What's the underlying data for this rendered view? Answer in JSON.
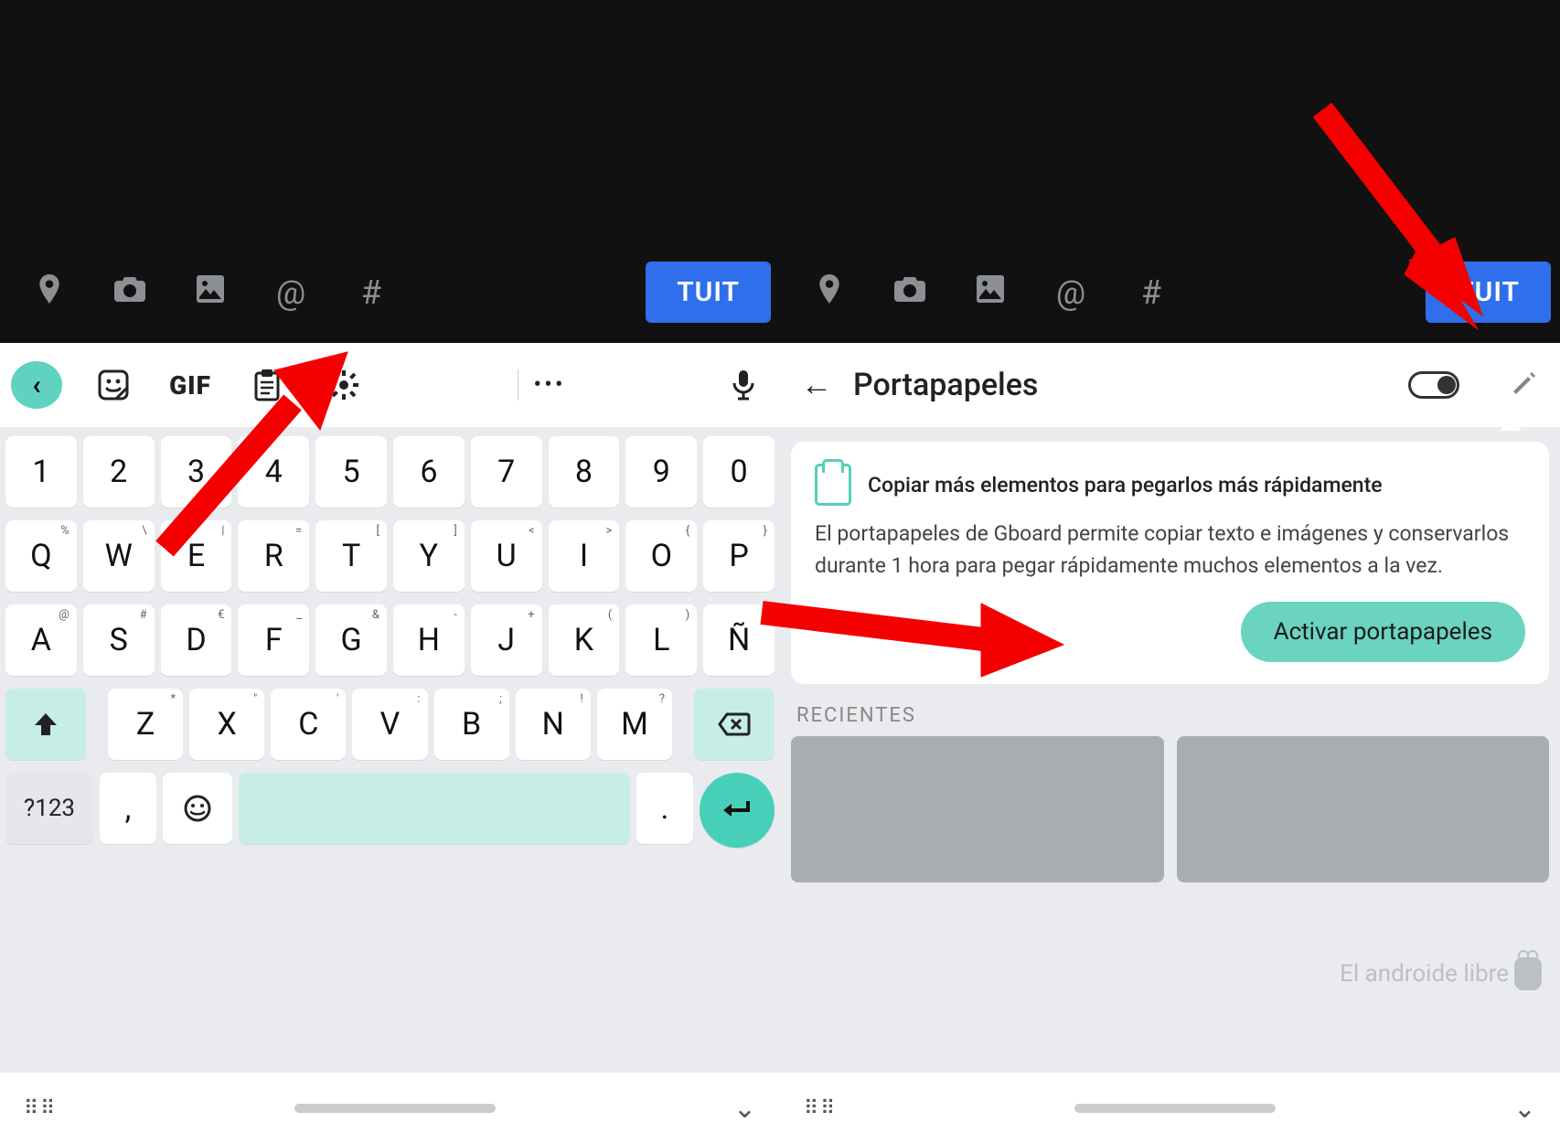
{
  "compose": {
    "icons": [
      "location",
      "camera",
      "gallery",
      "at",
      "hash"
    ],
    "button": "TUIT"
  },
  "strip": {
    "back": "‹",
    "sticker": "sticker",
    "gif": "GIF",
    "clipboard": "clipboard",
    "settings": "settings",
    "more": "•••",
    "mic": "mic"
  },
  "keys": {
    "row1": [
      "1",
      "2",
      "3",
      "4",
      "5",
      "6",
      "7",
      "8",
      "9",
      "0"
    ],
    "row2": [
      {
        "k": "Q",
        "s": "%"
      },
      {
        "k": "W",
        "s": "\\"
      },
      {
        "k": "E",
        "s": "|"
      },
      {
        "k": "R",
        "s": "="
      },
      {
        "k": "T",
        "s": "["
      },
      {
        "k": "Y",
        "s": "]"
      },
      {
        "k": "U",
        "s": "<"
      },
      {
        "k": "I",
        "s": ">"
      },
      {
        "k": "O",
        "s": "{"
      },
      {
        "k": "P",
        "s": "}"
      }
    ],
    "row3": [
      {
        "k": "A",
        "s": "@"
      },
      {
        "k": "S",
        "s": "#"
      },
      {
        "k": "D",
        "s": "€"
      },
      {
        "k": "F",
        "s": "_"
      },
      {
        "k": "G",
        "s": "&"
      },
      {
        "k": "H",
        "s": "-"
      },
      {
        "k": "J",
        "s": "+"
      },
      {
        "k": "K",
        "s": "("
      },
      {
        "k": "L",
        "s": ")"
      },
      {
        "k": "Ñ",
        "s": "/"
      }
    ],
    "row4": [
      {
        "k": "Z",
        "s": "*"
      },
      {
        "k": "X",
        "s": "\""
      },
      {
        "k": "C",
        "s": "'"
      },
      {
        "k": "V",
        "s": ":"
      },
      {
        "k": "B",
        "s": ";"
      },
      {
        "k": "N",
        "s": "!"
      },
      {
        "k": "M",
        "s": "?"
      }
    ],
    "shift": "⬆",
    "backspace": "⌫",
    "q123": "?123",
    "comma": ",",
    "emoji": "☺",
    "period": ".",
    "enter": "↵"
  },
  "clipboard": {
    "back": "←",
    "title": "Portapapeles",
    "card_head": "Copiar más elementos para pegarlos más rápidamente",
    "card_body": "El portapapeles de Gboard permite copiar texto e imágenes y conservarlos durante 1 hora para pegar rápidamente muchos elementos a la vez.",
    "activate": "Activar portapapeles",
    "recent": "RECIENTES"
  },
  "watermark": "El androide libre",
  "footer": {
    "chevron": "⌄"
  }
}
